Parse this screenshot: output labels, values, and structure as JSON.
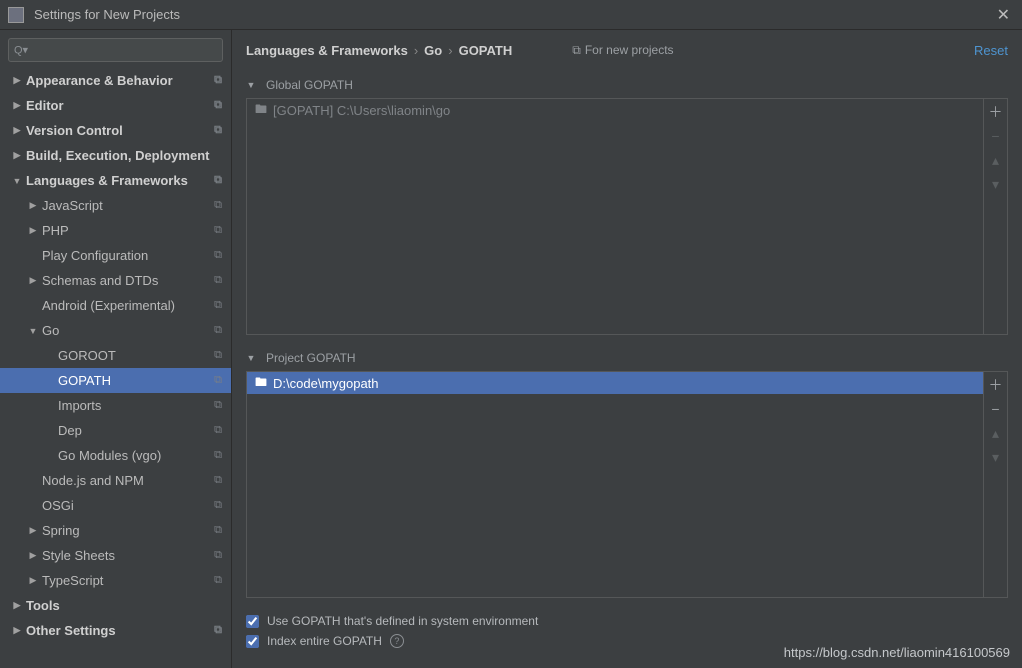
{
  "window": {
    "title": "Settings for New Projects"
  },
  "search": {
    "placeholder": ""
  },
  "tree": [
    {
      "label": "Appearance & Behavior",
      "depth": 0,
      "arrow": "right",
      "bold": true,
      "copy": true
    },
    {
      "label": "Editor",
      "depth": 0,
      "arrow": "right",
      "bold": true,
      "copy": true
    },
    {
      "label": "Version Control",
      "depth": 0,
      "arrow": "right",
      "bold": true,
      "copy": true
    },
    {
      "label": "Build, Execution, Deployment",
      "depth": 0,
      "arrow": "right",
      "bold": true,
      "copy": false
    },
    {
      "label": "Languages & Frameworks",
      "depth": 0,
      "arrow": "down",
      "bold": true,
      "copy": true
    },
    {
      "label": "JavaScript",
      "depth": 1,
      "arrow": "right",
      "bold": false,
      "copy": true
    },
    {
      "label": "PHP",
      "depth": 1,
      "arrow": "right",
      "bold": false,
      "copy": true
    },
    {
      "label": "Play Configuration",
      "depth": 1,
      "arrow": "none",
      "bold": false,
      "copy": true
    },
    {
      "label": "Schemas and DTDs",
      "depth": 1,
      "arrow": "right",
      "bold": false,
      "copy": true
    },
    {
      "label": "Android (Experimental)",
      "depth": 1,
      "arrow": "none",
      "bold": false,
      "copy": true
    },
    {
      "label": "Go",
      "depth": 1,
      "arrow": "down",
      "bold": false,
      "copy": true
    },
    {
      "label": "GOROOT",
      "depth": 2,
      "arrow": "none",
      "bold": false,
      "copy": true
    },
    {
      "label": "GOPATH",
      "depth": 2,
      "arrow": "none",
      "bold": false,
      "copy": true,
      "selected": true
    },
    {
      "label": "Imports",
      "depth": 2,
      "arrow": "none",
      "bold": false,
      "copy": true
    },
    {
      "label": "Dep",
      "depth": 2,
      "arrow": "none",
      "bold": false,
      "copy": true
    },
    {
      "label": "Go Modules (vgo)",
      "depth": 2,
      "arrow": "none",
      "bold": false,
      "copy": true
    },
    {
      "label": "Node.js and NPM",
      "depth": 1,
      "arrow": "none",
      "bold": false,
      "copy": true
    },
    {
      "label": "OSGi",
      "depth": 1,
      "arrow": "none",
      "bold": false,
      "copy": true
    },
    {
      "label": "Spring",
      "depth": 1,
      "arrow": "right",
      "bold": false,
      "copy": true
    },
    {
      "label": "Style Sheets",
      "depth": 1,
      "arrow": "right",
      "bold": false,
      "copy": true
    },
    {
      "label": "TypeScript",
      "depth": 1,
      "arrow": "right",
      "bold": false,
      "copy": true
    },
    {
      "label": "Tools",
      "depth": 0,
      "arrow": "right",
      "bold": true,
      "copy": false
    },
    {
      "label": "Other Settings",
      "depth": 0,
      "arrow": "right",
      "bold": true,
      "copy": true
    }
  ],
  "breadcrumb": {
    "a": "Languages & Frameworks",
    "b": "Go",
    "c": "GOPATH"
  },
  "for_new": "For new projects",
  "reset": "Reset",
  "global": {
    "title": "Global GOPATH",
    "items": [
      "[GOPATH] C:\\Users\\liaomin\\go"
    ]
  },
  "project": {
    "title": "Project GOPATH",
    "items": [
      "D:\\code\\mygopath"
    ]
  },
  "checks": {
    "use_system": "Use GOPATH that's defined in system environment",
    "index_entire": "Index entire GOPATH"
  },
  "watermark": "https://blog.csdn.net/liaomin416100569"
}
